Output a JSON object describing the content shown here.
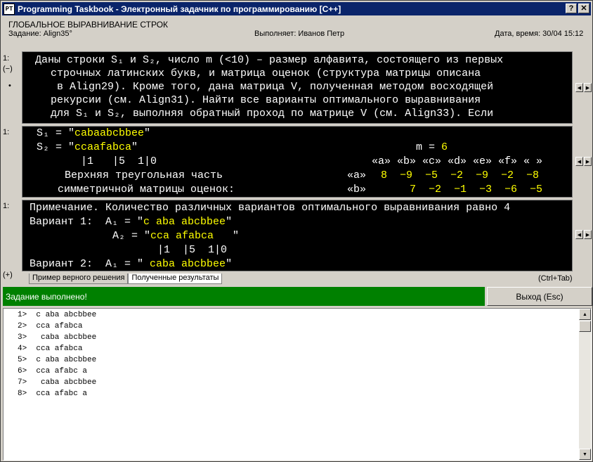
{
  "window": {
    "title": "Programming Taskbook - Электронный задачник по программированию [C++]",
    "icon_text": "PT"
  },
  "header": {
    "section": "ГЛОБАЛЬНОЕ ВЫРАВНИВАНИЕ СТРОК",
    "task": "Задание: Align35°",
    "performer": "Выполняет: Иванов Петр",
    "datetime": "Дата, время: 30/04 15:12"
  },
  "panels": {
    "p1_label": "1:",
    "p1_sub": "(−)",
    "p1_bullet": "•",
    "p1_lines": [
      "Даны строки S₁ и S₂, число m (<10) – размер алфавита, состоящего из первых",
      "строчных латинских букв, и матрица оценок (структура матрицы описана",
      "в Align29). Кроме того, дана матрица V, полученная методом восходящей",
      "рекурсии (см. Align31). Найти все варианты оптимального выравнивания",
      "для S₁ и S₂, выполняя обратный проход по матрице V (см. Align33). Если"
    ],
    "p2_label": "1:",
    "p2": {
      "s1_label": "S₁ = \"",
      "s1_value": "cabaabcbbee",
      "s2_label": "S₂ = \"",
      "s2_value": "ccaafabca",
      "quote": "\"",
      "m_label": "m = ",
      "m_value": "6",
      "ruler": "|1   |5  1|0",
      "upper_label": "Верхняя треугольная часть",
      "sym_label": "симметричной матрицы оценок:",
      "col_headers": "«a» «b» «c» «d» «e» «f» « »",
      "row_a_label": "«a»",
      "row_a_values": "8  −9  −5  −2  −9  −2  −8",
      "row_b_label": "«b»",
      "row_b_values": "7  −2  −1  −3  −6  −5"
    },
    "p3_label": "1:",
    "p3": {
      "note": "Примечание. Количество различных вариантов оптимального выравнивания равно 4",
      "v1_label": "Вариант 1:  A₁ = \"",
      "v1_a1": "c aba abcbbee",
      "a2_label": "A₂ = \"",
      "v1_a2": "cca afabca   ",
      "ruler": "|1  |5  1|0",
      "v2_label": "Вариант 2:  A₁ = \"",
      "v2_a1": " caba abcbbee",
      "quote": "\""
    },
    "plus_label": "(+)"
  },
  "tabs": [
    "Пример верного решения",
    "Полученные результаты"
  ],
  "ctrl_tab": "(Ctrl+Tab)",
  "status": "Задание выполнено!",
  "exit_button": "Выход (Esc)",
  "output_lines": [
    "1>  c aba abcbbee",
    "2>  cca afabca",
    "3>   caba abcbbee",
    "4>  cca afabca",
    "5>  c aba abcbbee",
    "6>  cca afabc a",
    "7>   caba abcbbee",
    "8>  cca afabc a"
  ],
  "colors": {
    "title_bg": "#0a246a",
    "status_bg": "#008000",
    "highlight": "#ffff00"
  }
}
